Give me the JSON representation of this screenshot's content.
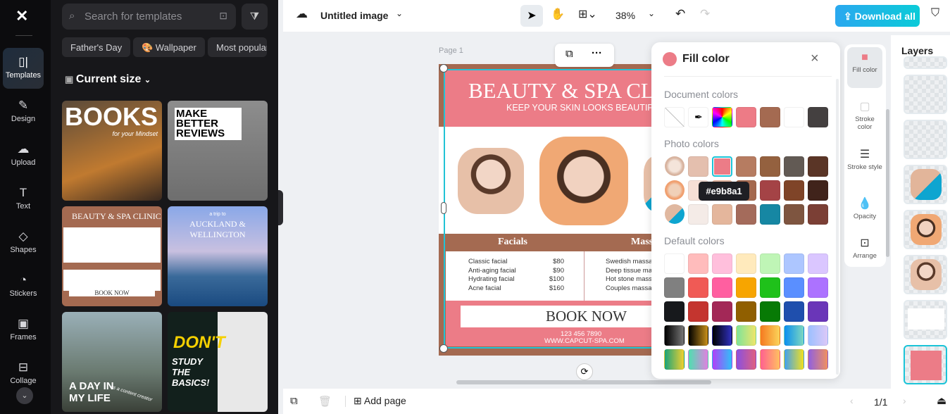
{
  "nav": {
    "items": [
      {
        "label": "Templates",
        "icon": "templates-icon",
        "active": true
      },
      {
        "label": "Design",
        "icon": "design-icon"
      },
      {
        "label": "Upload",
        "icon": "upload-icon"
      },
      {
        "label": "Text",
        "icon": "text-icon"
      },
      {
        "label": "Shapes",
        "icon": "shapes-icon"
      },
      {
        "label": "Stickers",
        "icon": "stickers-icon"
      },
      {
        "label": "Frames",
        "icon": "frames-icon"
      },
      {
        "label": "Collage",
        "icon": "collage-icon"
      }
    ]
  },
  "panel": {
    "search_placeholder": "Search for templates",
    "chips": [
      "Father's Day",
      "🎨 Wallpaper",
      "Most popular"
    ],
    "size_label": "Current size",
    "templates": [
      {
        "title": "BOOKS",
        "sub": "for your Mindset"
      },
      {
        "title": "MAKE BETTER REVIEWS"
      },
      {
        "title": "BEAUTY & SPA CLINIC",
        "sub": "BOOK NOW"
      },
      {
        "title": "AUCKLAND & WELLINGTON",
        "sub": "a trip to"
      },
      {
        "title": "A DAY IN MY LIFE",
        "sub": "as a content creator"
      },
      {
        "title": "DON'T",
        "sub": "STUDY THE BASICS!"
      }
    ]
  },
  "topbar": {
    "title": "Untitled image",
    "zoom": "38%",
    "download": "Download all"
  },
  "canvas": {
    "page_label": "Page 1",
    "poster": {
      "title": "BEAUTY & SPA CLINIC",
      "subtitle": "KEEP YOUR SKIN LOOKS BEAUTIFUL",
      "col1": "Facials",
      "col2": "Massages",
      "facials": [
        [
          "Classic facial",
          "$80"
        ],
        [
          "Anti-aging facial",
          "$90"
        ],
        [
          "Hydrating facial",
          "$100"
        ],
        [
          "Acne facial",
          "$160"
        ]
      ],
      "massages": [
        "Swedish massage",
        "Deep tissue massage",
        "Hot stone massage",
        "Couples massage"
      ],
      "cta": "BOOK NOW",
      "phone": "123 456 7890",
      "web": "WWW.CAPCUT-SPA.COM"
    }
  },
  "fill_popup": {
    "title": "Fill color",
    "current": "#ec7c87",
    "document_label": "Document colors",
    "photo_label": "Photo colors",
    "default_label": "Default colors",
    "tooltip": "#e9b8a1",
    "document_colors": [
      "#ed7b86",
      "#a46a51",
      "#ffffff",
      "#444040"
    ],
    "photo_colors": [
      [
        "#e4bfae",
        "#ec7c87",
        "#b67c61",
        "#94613f",
        "#625a54",
        "#5a3526"
      ],
      [
        "#f6dfd5",
        "#e9b8a1",
        "#a4694e",
        "#a44346",
        "#7f4428",
        "#40231b"
      ],
      [
        "#f4ebe7",
        "#e4b69c",
        "#a46b5b",
        "#1687a3",
        "#7e5540",
        "#7b3f35"
      ]
    ],
    "default_colors": [
      [
        "#ffffff",
        "#ffbcbc",
        "#ffbfdc",
        "#ffeabc",
        "#bff5b6",
        "#adc6ff",
        "#dac6ff"
      ],
      [
        "#808080",
        "#f05a55",
        "#ff5fa0",
        "#f7a500",
        "#1fc11a",
        "#5a8fff",
        "#ac72ff"
      ],
      [
        "#17191c",
        "#c4352f",
        "#a32857",
        "#905f00",
        "#077a05",
        "#1f4fad",
        "#6a36b8"
      ]
    ],
    "gradients": [
      [
        "#000,#777",
        "#000,#c8901a",
        "#000,#3030c0",
        "#7ee39a,#efe56a",
        "#f57a20,#fbd45a",
        "#0b8ff0,#7dd8c0",
        "#9cc0ff,#dcc8f8"
      ],
      [
        "#1aa37a,#f0d030",
        "#4ee0b0,#e080e0",
        "#b040f8,#30c0f8",
        "#8a50e0,#e06080",
        "#ff6090,#ffc060",
        "#40a0f0,#f0e020",
        "#9060e0,#f09060"
      ]
    ]
  },
  "tools": [
    {
      "label": "Fill color",
      "icon": "fill-color-icon"
    },
    {
      "label": "Stroke color",
      "icon": "stroke-color-icon"
    },
    {
      "label": "Stroke style",
      "icon": "stroke-style-icon"
    },
    {
      "label": "Opacity",
      "icon": "opacity-icon"
    },
    {
      "label": "Arrange",
      "icon": "arrange-icon"
    }
  ],
  "layers": {
    "title": "Layers"
  },
  "bottombar": {
    "add_page": "Add page",
    "page_count": "1/1"
  }
}
